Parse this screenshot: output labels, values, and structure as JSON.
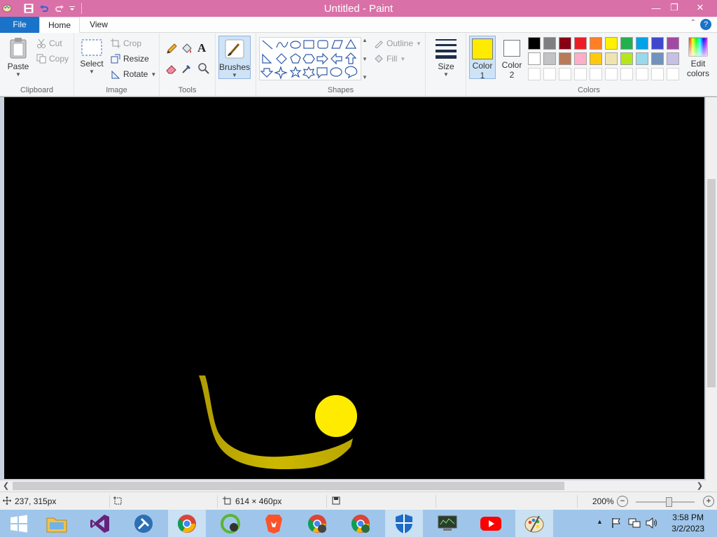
{
  "window": {
    "title": "Untitled - Paint",
    "min_glyph": "—",
    "restore_glyph": "❐",
    "close_glyph": "✕"
  },
  "tabs": {
    "file": "File",
    "home": "Home",
    "view": "View",
    "help_glyph": "?"
  },
  "ribbon": {
    "clipboard": {
      "label": "Clipboard",
      "paste": "Paste",
      "cut": "Cut",
      "copy": "Copy"
    },
    "image": {
      "label": "Image",
      "select": "Select",
      "crop": "Crop",
      "resize": "Resize",
      "rotate": "Rotate"
    },
    "tools": {
      "label": "Tools",
      "text_glyph": "A"
    },
    "brushes": {
      "label": "Brushes"
    },
    "shapes": {
      "label": "Shapes",
      "outline": "Outline",
      "fill": "Fill"
    },
    "size": {
      "label": "Size"
    },
    "colors": {
      "label": "Colors",
      "color1_line1": "Color",
      "color1_line2": "1",
      "color2_line1": "Color",
      "color2_line2": "2",
      "edit_line1": "Edit",
      "edit_line2": "colors",
      "color1_value": "#ffeb00",
      "color2_value": "#ffffff",
      "row1": [
        "#000000",
        "#7f7f7f",
        "#880015",
        "#ed1c24",
        "#ff7f27",
        "#fff200",
        "#22b14c",
        "#00a2e8",
        "#3f48cc",
        "#a349a4"
      ],
      "row2": [
        "#ffffff",
        "#c3c3c3",
        "#b97a57",
        "#ffaec9",
        "#ffc90e",
        "#efe4b0",
        "#b5e61d",
        "#99d9ea",
        "#7092be",
        "#c8bfe7"
      ]
    }
  },
  "status": {
    "cursor_pos": "237, 315px",
    "canvas_size": "614 × 460px",
    "zoom": "200%"
  },
  "taskbar": {
    "time": "3:58 PM",
    "date": "3/2/2023"
  },
  "accent": {
    "pink": "#da70a8",
    "blue": "#1a73c8",
    "yellow": "#ffeb00"
  }
}
